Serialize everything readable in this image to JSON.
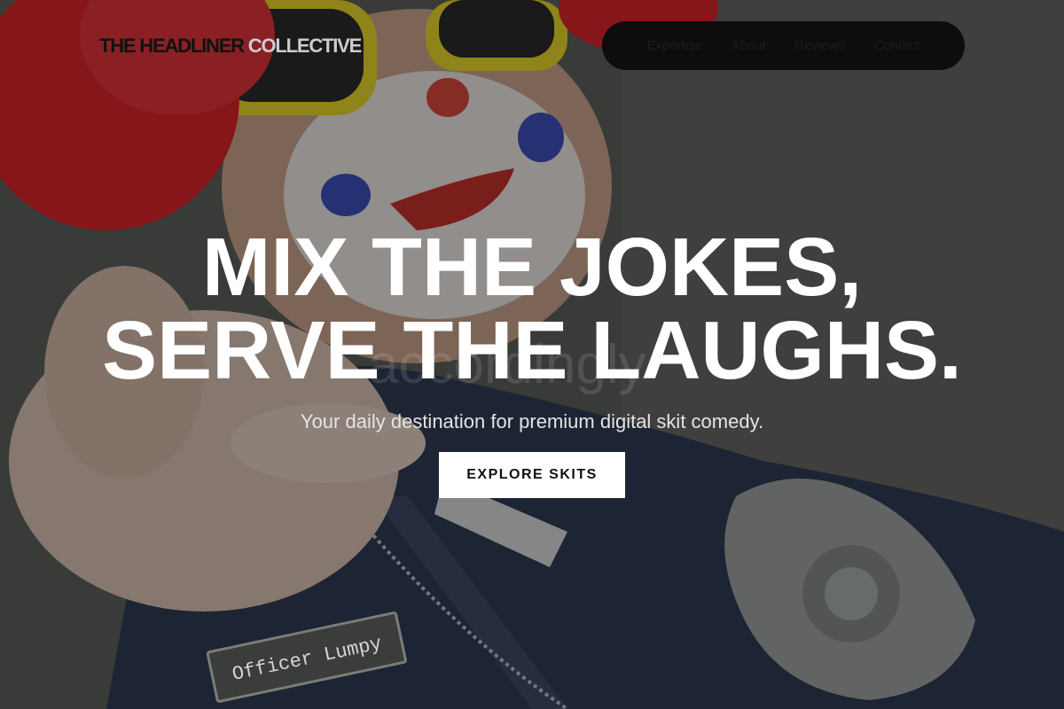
{
  "brand": {
    "part1": "THE HEADLINER",
    "part2": "COLLECTIVE"
  },
  "nav": {
    "items": [
      {
        "label": "Expertise"
      },
      {
        "label": "About"
      },
      {
        "label": "Reviews"
      },
      {
        "label": "Contact"
      }
    ]
  },
  "hero": {
    "headline_line1": "MIX THE JOKES,",
    "headline_line2": "SERVE THE LAUGHS.",
    "ghost_text": "accordingly",
    "subtitle": "Your daily destination for premium digital skit comedy.",
    "cta_label": "EXPLORE SKITS",
    "badge_text": "Officer Lumpy"
  },
  "colors": {
    "accent": "#ffffff",
    "nav_bg": "#0d0d0d",
    "wig": "#d8242b",
    "glasses": "#e6d52a",
    "uniform": "#2e3a52"
  },
  "background": {
    "description_icon": "clown-cop-photo"
  }
}
